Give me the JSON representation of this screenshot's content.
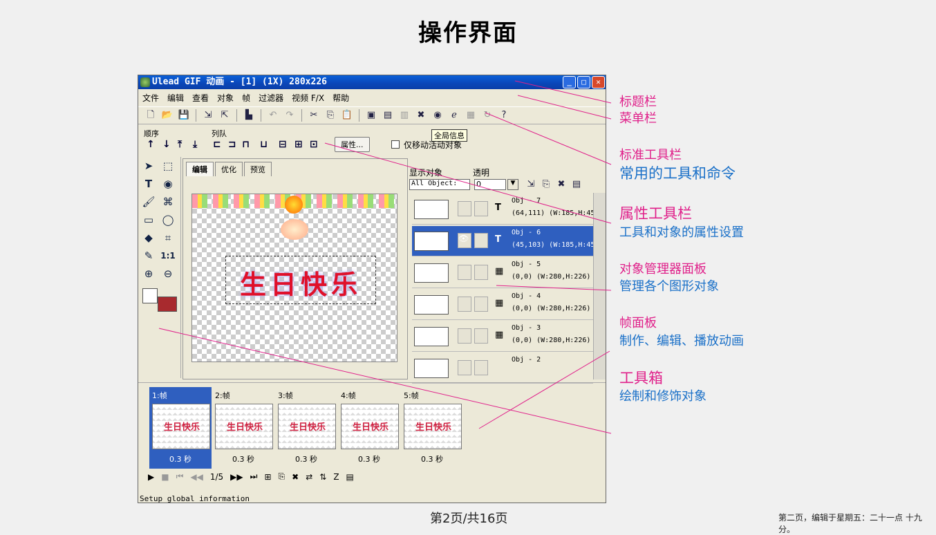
{
  "slide": {
    "title": "操作界面"
  },
  "app": {
    "title": "Ulead GIF 动画 - [1] (1X) 280x226",
    "menu": [
      "文件",
      "编辑",
      "查看",
      "对象",
      "帧",
      "过滤器",
      "视频 F/X",
      "帮助"
    ],
    "tooltip": "全局信息",
    "propbar": {
      "order_label": "顺序",
      "queue_label": "列队",
      "props_button": "属性...",
      "checkbox_label": "仅移动活动对象"
    },
    "tabs": [
      "编辑",
      "优化",
      "预览"
    ],
    "greeting": "生日快乐",
    "obj_panel": {
      "show_label": "显示对象",
      "opacity_label": "透明",
      "filter_value": "All Object:",
      "opacity_value": "0",
      "objects": [
        {
          "name": "Obj - 7",
          "geo": "(64,111) (W:185,H:45)",
          "icon": "T",
          "selected": false
        },
        {
          "name": "Obj - 6",
          "geo": "(45,103) (W:185,H:45)",
          "icon": "T",
          "selected": true
        },
        {
          "name": "Obj - 5",
          "geo": "(0,0) (W:280,H:226)",
          "icon": "▦",
          "selected": false
        },
        {
          "name": "Obj - 4",
          "geo": "(0,0) (W:280,H:226)",
          "icon": "▦",
          "selected": false
        },
        {
          "name": "Obj - 3",
          "geo": "(0,0) (W:280,H:226)",
          "icon": "▦",
          "selected": false
        },
        {
          "name": "Obj - 2",
          "geo": "",
          "icon": "",
          "selected": false
        }
      ]
    },
    "frames": [
      {
        "label": "1:帧",
        "delay": "0.3 秒",
        "selected": true
      },
      {
        "label": "2:帧",
        "delay": "0.3 秒",
        "selected": false
      },
      {
        "label": "3:帧",
        "delay": "0.3 秒",
        "selected": false
      },
      {
        "label": "4:帧",
        "delay": "0.3 秒",
        "selected": false
      },
      {
        "label": "5:帧",
        "delay": "0.3 秒",
        "selected": false
      }
    ],
    "frame_counter": "1/5",
    "status": "Setup global information"
  },
  "annotations": {
    "title_bar": "标题栏",
    "menu_bar": "菜单栏",
    "std_toolbar": "标准工具栏",
    "std_toolbar_desc": "常用的工具和命令",
    "prop_toolbar": "属性工具栏",
    "prop_toolbar_desc": "工具和对象的属性设置",
    "obj_manager": "对象管理器面板",
    "obj_manager_desc": "管理各个图形对象",
    "frame_panel": "帧面板",
    "frame_panel_desc": "制作、编辑、播放动画",
    "toolbox": "工具箱",
    "toolbox_desc": "绘制和修饰对象"
  },
  "footer": {
    "page": "第2页/共16页",
    "right": "第二页，编辑于星期五：二十一点 十九分。"
  },
  "colors": {
    "annotation_pink": "#e0208a",
    "annotation_blue": "#1a70c8",
    "selection_blue": "#2f5fbf",
    "greeting_red": "#e0102a"
  }
}
